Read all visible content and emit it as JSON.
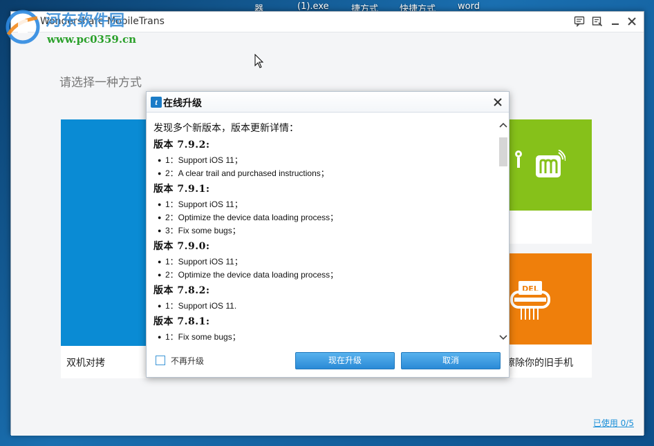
{
  "desktop": {
    "labels": [
      "器",
      "(1).exe",
      "捷方式",
      "快捷方式",
      "word"
    ]
  },
  "watermark": {
    "title": "河东软件园",
    "url": "www.pc0359.cn"
  },
  "app": {
    "title": "Wondershare MobileTrans",
    "heading": "请选择一种方式",
    "cards": {
      "transfer_label": "双机对拷",
      "erase_label": "擦除你的旧手机"
    },
    "usage_link": "已使用 0/5",
    "colors": {
      "blue_card": "#0a8bd4",
      "green_card": "#86c11a",
      "orange_card": "#ef7f0b"
    }
  },
  "dialog": {
    "title": "在线升级",
    "intro": "发现多个新版本，版本更新详情：",
    "versions": [
      {
        "title": "版本 7.9.2:",
        "notes": [
          "1：Support iOS 11；",
          "2：A clear trail and purchased instructions；"
        ]
      },
      {
        "title": "版本 7.9.1:",
        "notes": [
          "1：Support iOS 11；",
          "2：Optimize the device data loading process；",
          "3：Fix some bugs；"
        ]
      },
      {
        "title": "版本 7.9.0:",
        "notes": [
          "1：Support iOS 11；",
          "2：Optimize the device data loading process；"
        ]
      },
      {
        "title": "版本 7.8.2:",
        "notes": [
          "1：Support iOS 11."
        ]
      },
      {
        "title": "版本 7.8.1:",
        "notes": [
          "1：Fix some bugs；"
        ]
      }
    ],
    "checkbox_label": "不再升级",
    "upgrade_button": "现在升级",
    "cancel_button": "取消"
  }
}
